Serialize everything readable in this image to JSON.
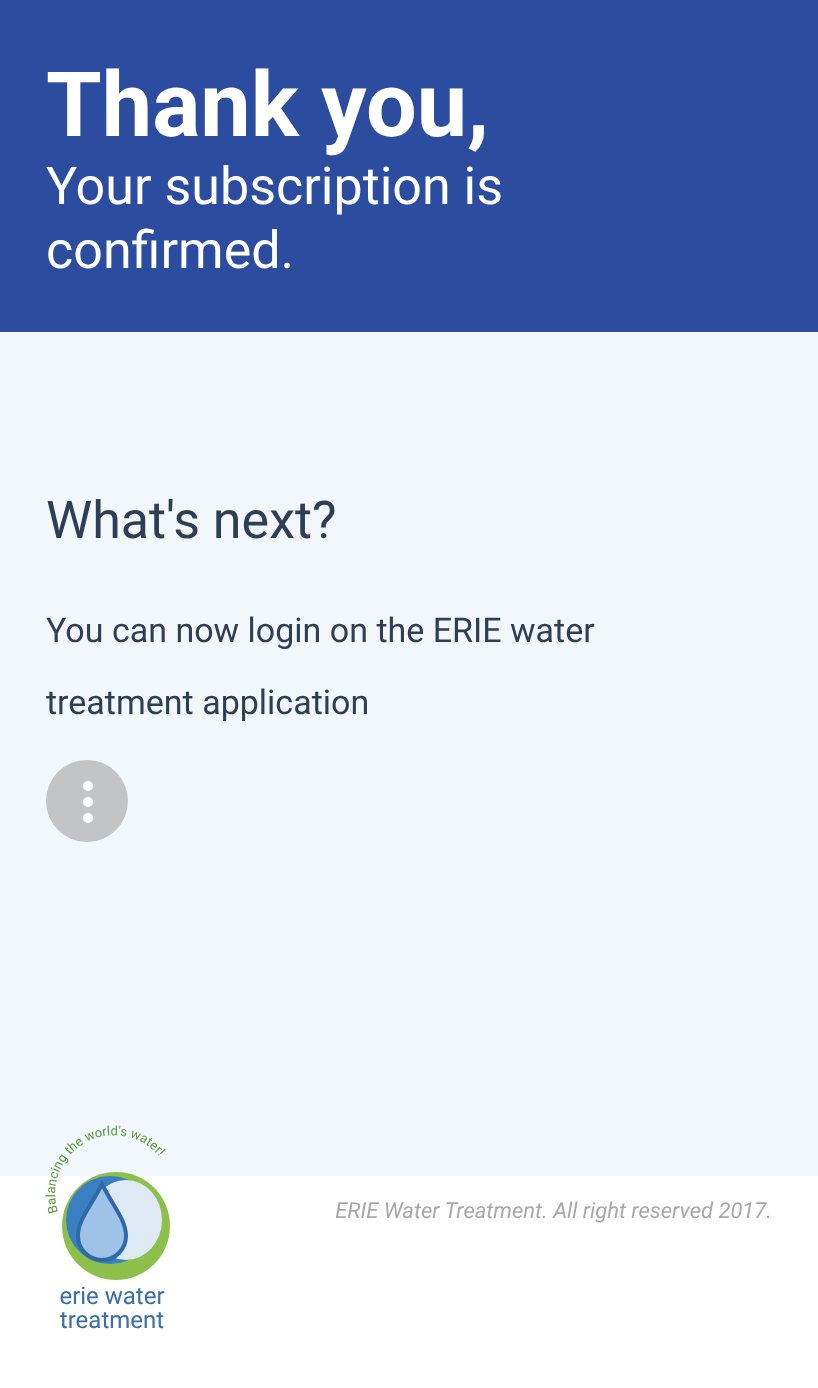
{
  "header": {
    "title": "Thank you,",
    "subtitle": "Your subscription is confirmed."
  },
  "content": {
    "heading": "What's next?",
    "text": "You can now login on the ERIE water treatment application",
    "more_button": true
  },
  "footer": {
    "logo": {
      "tagline": "Balancing the world's water!",
      "name_line_1": "erie water",
      "name_line_2": "treatment"
    },
    "copyright": "ERIE Water Treatment. All right reserved 2017."
  }
}
